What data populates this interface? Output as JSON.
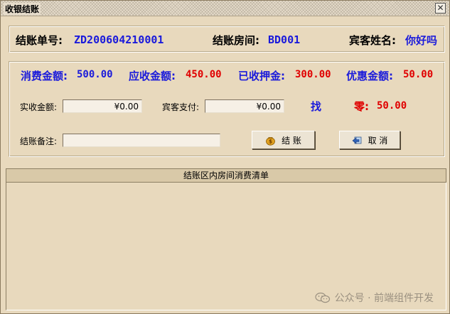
{
  "window": {
    "title": "收银结账",
    "close_glyph": "✕"
  },
  "info": {
    "bill_no_label": "结账单号:",
    "bill_no_value": "ZD200604210001",
    "room_label": "结账房间:",
    "room_value": "BD001",
    "guest_label": "宾客姓名:",
    "guest_value": "你好吗"
  },
  "amounts": {
    "consume_label": "消费金额:",
    "consume_value": "500.00",
    "receivable_label": "应收金额:",
    "receivable_value": "450.00",
    "deposit_label": "已收押金:",
    "deposit_value": "300.00",
    "discount_label": "优惠金额:",
    "discount_value": "50.00"
  },
  "payment": {
    "actual_label": "实收金额:",
    "actual_value": "¥0.00",
    "guest_pay_label": "宾客支付:",
    "guest_pay_value": "¥0.00",
    "change_label_1": "找",
    "change_label_2": "零:",
    "change_value": "50.00",
    "remark_label": "结账备注:",
    "remark_value": ""
  },
  "buttons": {
    "checkout_label": "结  账",
    "cancel_label": "取  消"
  },
  "list": {
    "header": "结账区内房间消费清单"
  },
  "watermark": {
    "text": "公众号 · 前端组件开发"
  },
  "colors": {
    "blue": "#1a1adb",
    "red": "#e00000",
    "background": "#e8d9bd"
  },
  "icons": {
    "checkout": "money-bag-icon",
    "cancel": "cancel-arrow-icon",
    "close": "close-icon"
  }
}
